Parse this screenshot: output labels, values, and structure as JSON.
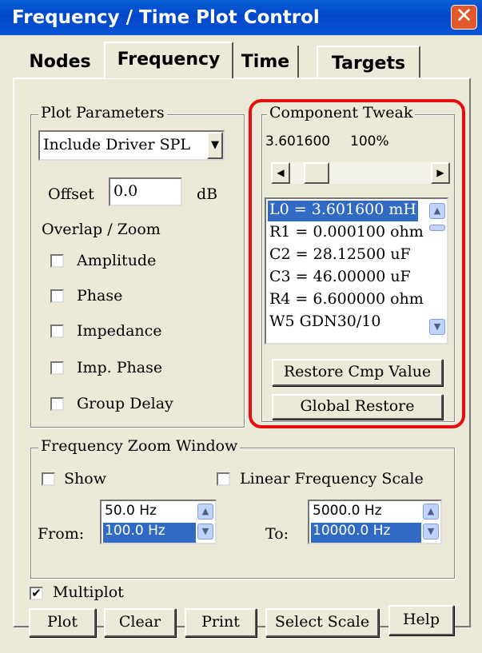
{
  "window": {
    "title": "Frequency / Time Plot Control",
    "close_label": "✕"
  },
  "tabs": [
    {
      "label": "Nodes"
    },
    {
      "label": "Frequency"
    },
    {
      "label": "Time"
    },
    {
      "label": "Targets"
    }
  ],
  "plot_parameters": {
    "legend": "Plot Parameters",
    "select_value": "Include Driver SPL",
    "offset_label": "Offset",
    "offset_value": "0.0",
    "offset_unit": "dB",
    "overlap_label": "Overlap / Zoom",
    "checkboxes": [
      {
        "label": "Amplitude",
        "checked": false
      },
      {
        "label": "Phase",
        "checked": false
      },
      {
        "label": "Impedance",
        "checked": false
      },
      {
        "label": "Imp. Phase",
        "checked": false
      },
      {
        "label": "Group Delay",
        "checked": false
      }
    ]
  },
  "component_tweak": {
    "legend": "Component Tweak",
    "value": "3.601600",
    "percent": "100%",
    "slider_level": 0.12,
    "items": [
      "L0 = 3.601600 mH",
      "R1 = 0.000100 ohm",
      "C2 = 28.12500 uF",
      "C3 = 46.00000 uF",
      "R4 = 6.600000 ohm",
      "W5 GDN30/10"
    ],
    "selected_index": 0,
    "restore_cmp_label": "Restore Cmp Value",
    "global_restore_label": "Global Restore",
    "highlight_color": "#e40e0e"
  },
  "zoom_window": {
    "legend": "Frequency Zoom Window",
    "show_label": "Show",
    "show_checked": false,
    "linear_label": "Linear Frequency Scale",
    "linear_checked": false,
    "from_label": "From:",
    "from_items": [
      "50.0 Hz",
      "100.0 Hz"
    ],
    "to_label": "To:",
    "to_items": [
      "5000.0 Hz",
      "10000.0 Hz"
    ]
  },
  "multiplot": {
    "label": "Multiplot",
    "checked": true,
    "check_glyph": "✔"
  },
  "buttons": {
    "plot": "Plot",
    "clear": "Clear",
    "print": "Print",
    "select_scale": "Select Scale",
    "help": "Help"
  },
  "colors": {
    "title_bar": "#0047c8",
    "selection": "#316ac5",
    "face": "#ece9d8"
  }
}
